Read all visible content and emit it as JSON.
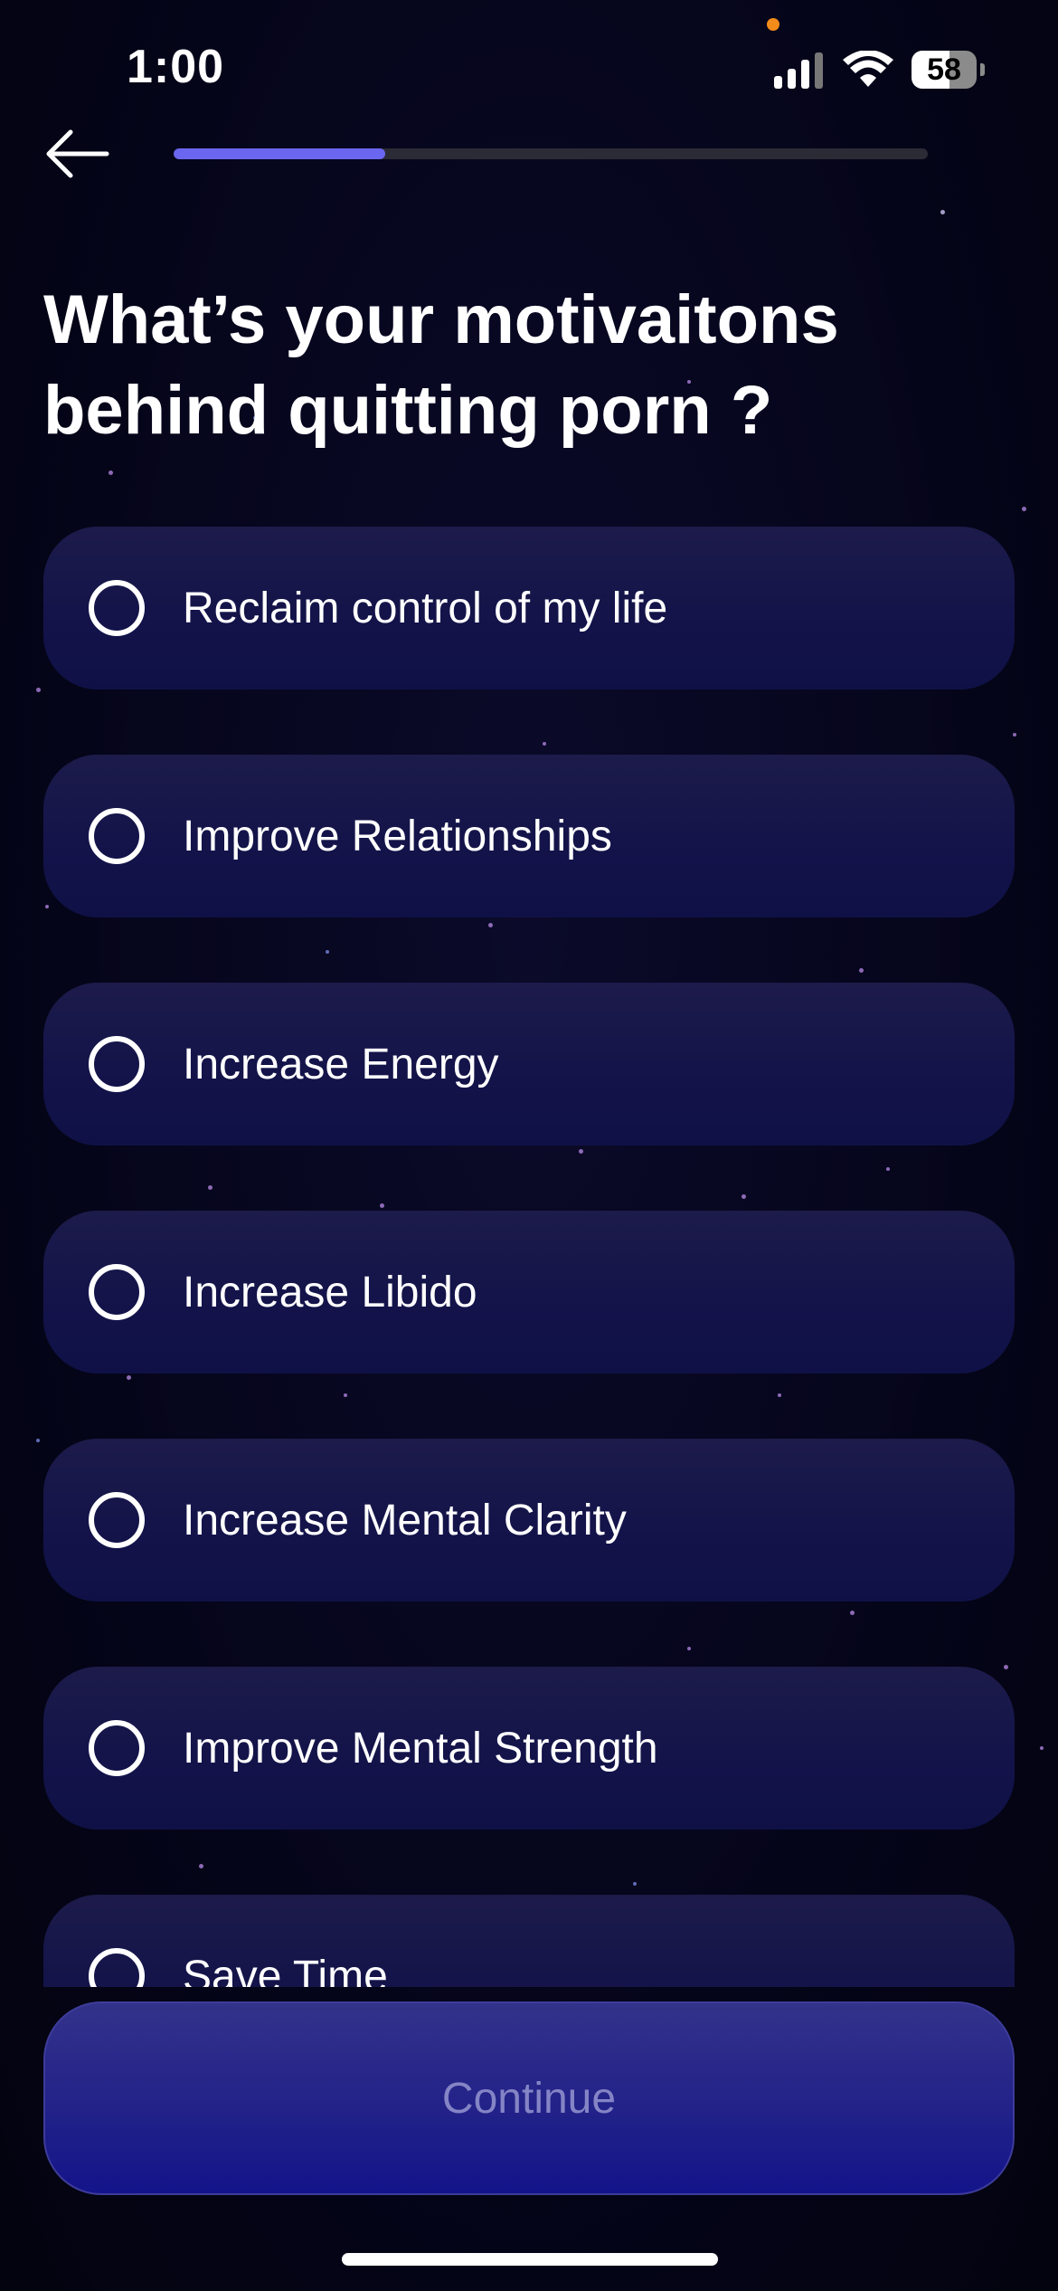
{
  "status_bar": {
    "time": "1:00",
    "battery_level": "58",
    "icons": [
      "cellular-signal-icon",
      "wifi-icon",
      "battery-icon"
    ]
  },
  "header": {
    "back_icon": "arrow-left-icon",
    "progress_fraction": 0.28
  },
  "question": "What’s your motivaitons behind quitting porn ?",
  "options": [
    {
      "label": "Reclaim control of my life",
      "selected": false
    },
    {
      "label": "Improve Relationships",
      "selected": false
    },
    {
      "label": "Increase Energy",
      "selected": false
    },
    {
      "label": "Increase Libido",
      "selected": false
    },
    {
      "label": "Increase Mental Clarity",
      "selected": false
    },
    {
      "label": "Improve Mental Strength",
      "selected": false
    },
    {
      "label": "Save Time",
      "selected": false
    }
  ],
  "continue_button": {
    "label": "Continue",
    "enabled": false
  },
  "colors": {
    "background": "#05051a",
    "accent": "#6a66f0",
    "option_card": "#16164a",
    "continue_button": "#222289"
  }
}
